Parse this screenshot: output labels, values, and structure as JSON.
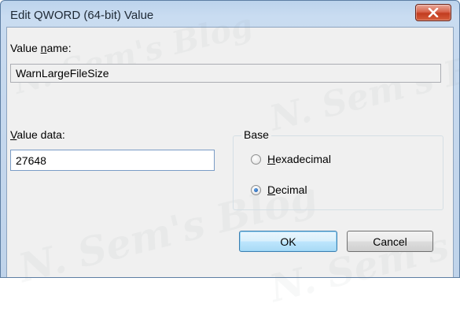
{
  "dialog": {
    "title": "Edit QWORD (64-bit) Value",
    "close_icon": "close-icon"
  },
  "value_name": {
    "label_prefix": "Value ",
    "label_mnemonic": "n",
    "label_suffix": "ame:",
    "value": "WarnLargeFileSize"
  },
  "value_data": {
    "label_mnemonic": "V",
    "label_suffix": "alue data:",
    "value": "27648"
  },
  "base": {
    "legend": "Base",
    "options": [
      {
        "mnemonic": "H",
        "rest": "exadecimal",
        "checked": false
      },
      {
        "mnemonic": "D",
        "rest": "ecimal",
        "checked": true
      }
    ]
  },
  "buttons": {
    "ok": "OK",
    "cancel": "Cancel"
  },
  "watermark": "N. Sem's Blog"
}
